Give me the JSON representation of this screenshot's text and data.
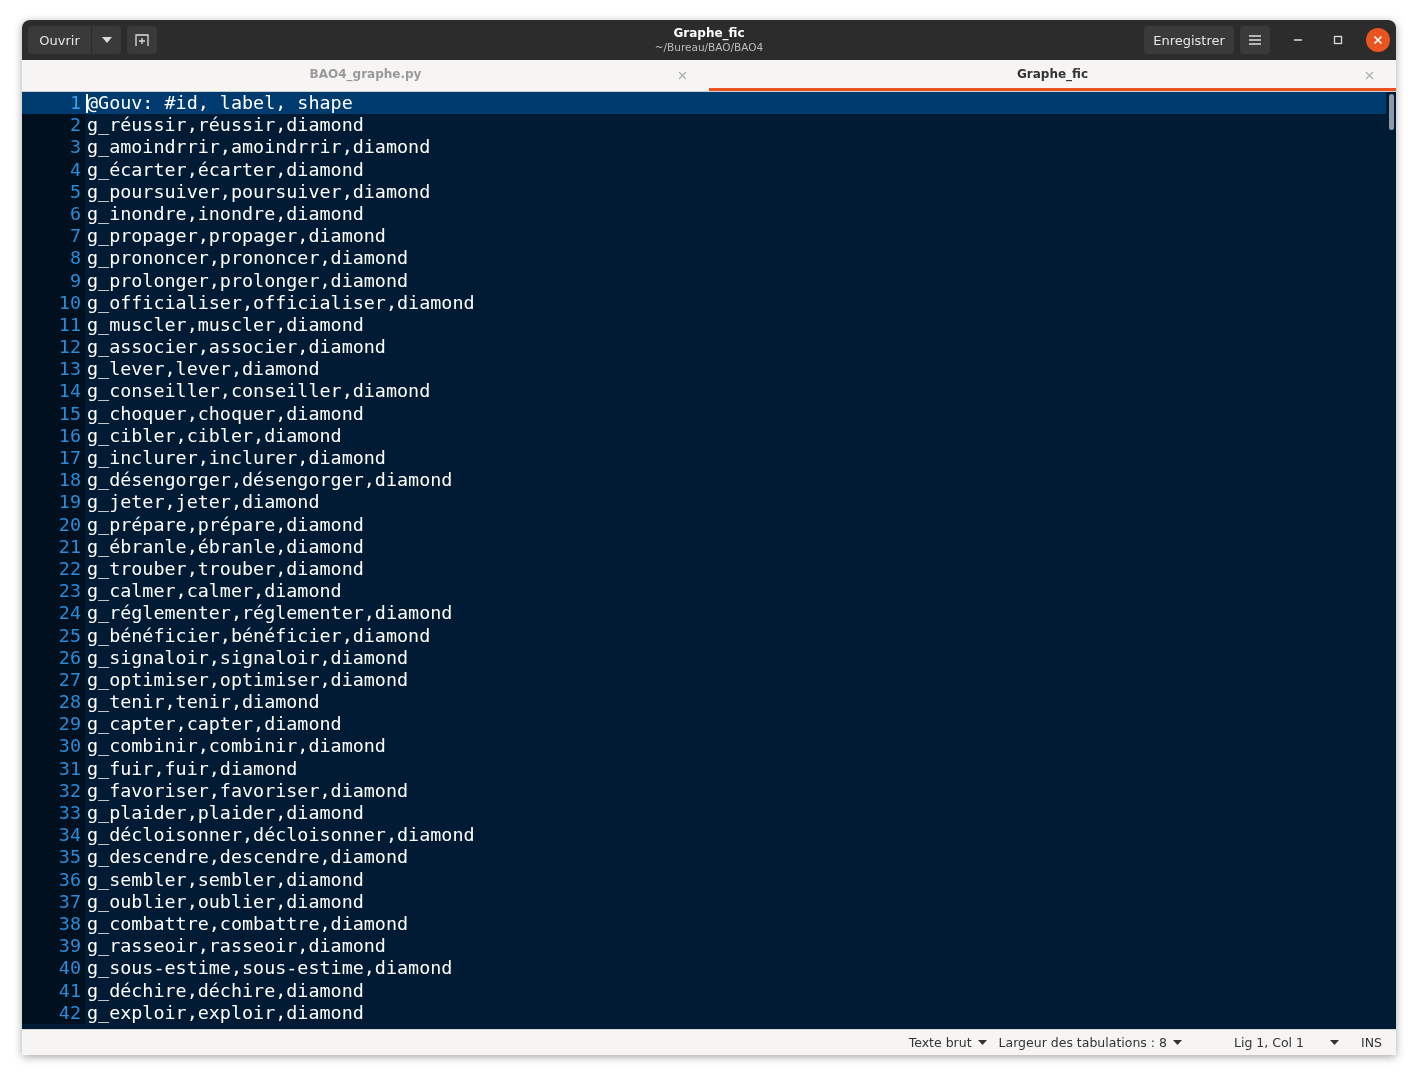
{
  "header": {
    "open_button": "Ouvrir",
    "title": "Graphe_fic",
    "subtitle": "~/Bureau/BAO/BAO4",
    "save_button": "Enregistrer"
  },
  "tabs": [
    {
      "label": "BAO4_graphe.py",
      "selected": false
    },
    {
      "label": "Graphe_fic",
      "selected": true
    }
  ],
  "editor": {
    "lines": [
      {
        "number": "1",
        "text": "@Gouv: #id, label, shape",
        "current": true
      },
      {
        "number": "2",
        "text": "g_réussir,réussir,diamond",
        "current": false
      },
      {
        "number": "3",
        "text": "g_amoindrrir,amoindrrir,diamond",
        "current": false
      },
      {
        "number": "4",
        "text": "g_écarter,écarter,diamond",
        "current": false
      },
      {
        "number": "5",
        "text": "g_poursuiver,poursuiver,diamond",
        "current": false
      },
      {
        "number": "6",
        "text": "g_inondre,inondre,diamond",
        "current": false
      },
      {
        "number": "7",
        "text": "g_propager,propager,diamond",
        "current": false
      },
      {
        "number": "8",
        "text": "g_prononcer,prononcer,diamond",
        "current": false
      },
      {
        "number": "9",
        "text": "g_prolonger,prolonger,diamond",
        "current": false
      },
      {
        "number": "10",
        "text": "g_officialiser,officialiser,diamond",
        "current": false
      },
      {
        "number": "11",
        "text": "g_muscler,muscler,diamond",
        "current": false
      },
      {
        "number": "12",
        "text": "g_associer,associer,diamond",
        "current": false
      },
      {
        "number": "13",
        "text": "g_lever,lever,diamond",
        "current": false
      },
      {
        "number": "14",
        "text": "g_conseiller,conseiller,diamond",
        "current": false
      },
      {
        "number": "15",
        "text": "g_choquer,choquer,diamond",
        "current": false
      },
      {
        "number": "16",
        "text": "g_cibler,cibler,diamond",
        "current": false
      },
      {
        "number": "17",
        "text": "g_inclurer,inclurer,diamond",
        "current": false
      },
      {
        "number": "18",
        "text": "g_désengorger,désengorger,diamond",
        "current": false
      },
      {
        "number": "19",
        "text": "g_jeter,jeter,diamond",
        "current": false
      },
      {
        "number": "20",
        "text": "g_prépare,prépare,diamond",
        "current": false
      },
      {
        "number": "21",
        "text": "g_ébranle,ébranle,diamond",
        "current": false
      },
      {
        "number": "22",
        "text": "g_trouber,trouber,diamond",
        "current": false
      },
      {
        "number": "23",
        "text": "g_calmer,calmer,diamond",
        "current": false
      },
      {
        "number": "24",
        "text": "g_réglementer,réglementer,diamond",
        "current": false
      },
      {
        "number": "25",
        "text": "g_bénéficier,bénéficier,diamond",
        "current": false
      },
      {
        "number": "26",
        "text": "g_signaloir,signaloir,diamond",
        "current": false
      },
      {
        "number": "27",
        "text": "g_optimiser,optimiser,diamond",
        "current": false
      },
      {
        "number": "28",
        "text": "g_tenir,tenir,diamond",
        "current": false
      },
      {
        "number": "29",
        "text": "g_capter,capter,diamond",
        "current": false
      },
      {
        "number": "30",
        "text": "g_combinir,combinir,diamond",
        "current": false
      },
      {
        "number": "31",
        "text": "g_fuir,fuir,diamond",
        "current": false
      },
      {
        "number": "32",
        "text": "g_favoriser,favoriser,diamond",
        "current": false
      },
      {
        "number": "33",
        "text": "g_plaider,plaider,diamond",
        "current": false
      },
      {
        "number": "34",
        "text": "g_décloisonner,décloisonner,diamond",
        "current": false
      },
      {
        "number": "35",
        "text": "g_descendre,descendre,diamond",
        "current": false
      },
      {
        "number": "36",
        "text": "g_sembler,sembler,diamond",
        "current": false
      },
      {
        "number": "37",
        "text": "g_oublier,oublier,diamond",
        "current": false
      },
      {
        "number": "38",
        "text": "g_combattre,combattre,diamond",
        "current": false
      },
      {
        "number": "39",
        "text": "g_rasseoir,rasseoir,diamond",
        "current": false
      },
      {
        "number": "40",
        "text": "g_sous-estime,sous-estime,diamond",
        "current": false
      },
      {
        "number": "41",
        "text": "g_déchire,déchire,diamond",
        "current": false
      },
      {
        "number": "42",
        "text": "g_exploir,exploir,diamond",
        "current": false
      }
    ]
  },
  "status_bar": {
    "language": "Texte brut",
    "tab_width": "Largeur des tabulations : 8",
    "position": "Lig 1, Col 1",
    "mode": "INS"
  }
}
